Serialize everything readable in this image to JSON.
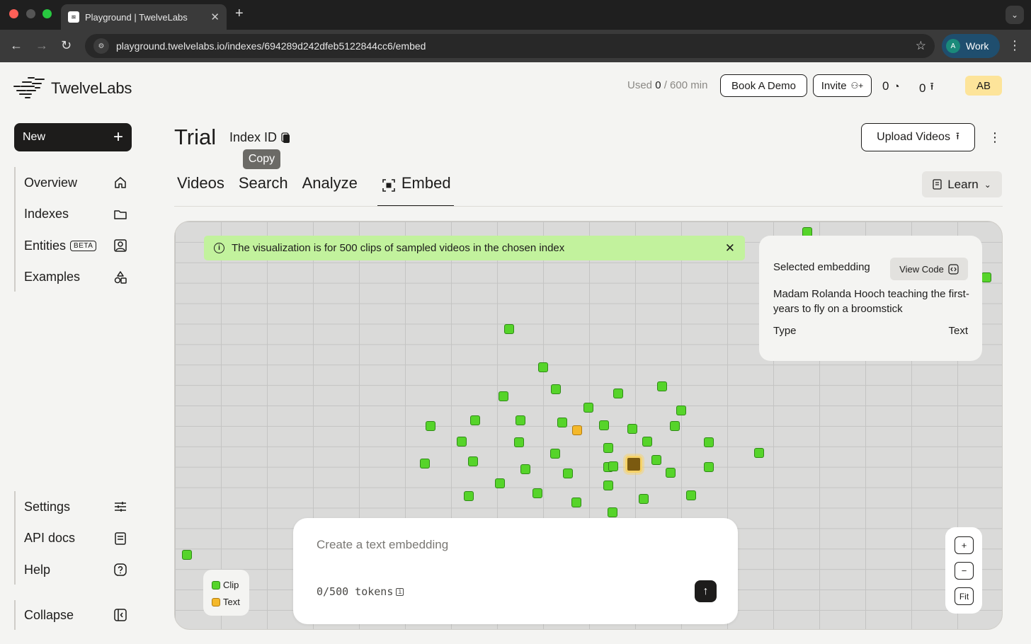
{
  "browser": {
    "tab_title": "Playground | TwelveLabs",
    "url": "playground.twelvelabs.io/indexes/694289d242dfeb5122844cc6/embed",
    "profile_initial": "A",
    "profile_label": "Work"
  },
  "header": {
    "brand": "TwelveLabs",
    "usage_prefix": "Used",
    "usage_used": "0",
    "usage_total": "/ 600 min",
    "book_demo": "Book A Demo",
    "invite": "Invite",
    "counter_a": "0",
    "counter_b": "0",
    "avatar": "AB"
  },
  "sidebar": {
    "new_label": "New",
    "items": [
      {
        "label": "Overview",
        "icon": "home-icon"
      },
      {
        "label": "Indexes",
        "icon": "folder-icon"
      },
      {
        "label": "Entities",
        "badge": "BETA",
        "icon": "person-card-icon"
      },
      {
        "label": "Examples",
        "icon": "shapes-icon"
      }
    ],
    "bottom": [
      {
        "label": "Settings",
        "icon": "sliders-icon"
      },
      {
        "label": "API docs",
        "icon": "document-icon"
      },
      {
        "label": "Help",
        "icon": "help-icon"
      }
    ],
    "collapse": "Collapse"
  },
  "main": {
    "title": "Trial",
    "index_id_label": "Index ID",
    "copy_tooltip": "Copy",
    "upload": "Upload Videos",
    "learn": "Learn",
    "tabs": [
      "Videos",
      "Search",
      "Analyze",
      "Embed"
    ],
    "active_tab": "Embed"
  },
  "visualization": {
    "banner": "The visualization is for 500 clips of sampled videos in the chosen index",
    "selected": {
      "heading": "Selected embedding",
      "view_code": "View Code",
      "description": "Madam Rolanda Hooch teaching the first-years to fly on a broomstick",
      "type_label": "Type",
      "type_value": "Text"
    },
    "legend": [
      {
        "label": "Clip",
        "color": "#56d42a"
      },
      {
        "label": "Text",
        "color": "#f4b82a"
      }
    ],
    "composer": {
      "placeholder": "Create a text embedding",
      "tokens": "0/500 tokens"
    },
    "zoom": {
      "in": "+",
      "out": "−",
      "fit": "Fit"
    }
  }
}
